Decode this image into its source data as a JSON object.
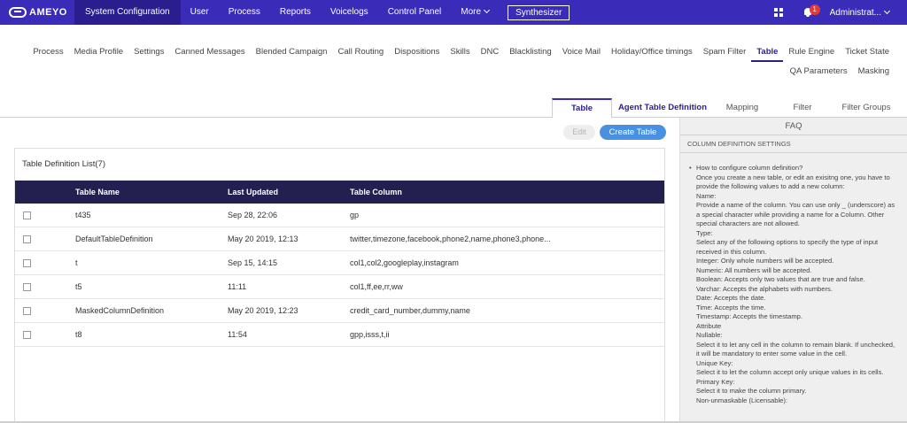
{
  "topbar": {
    "logo_text": "AMEYO",
    "nav": [
      {
        "label": "System Configuration",
        "active": true
      },
      {
        "label": "User"
      },
      {
        "label": "Process"
      },
      {
        "label": "Reports"
      },
      {
        "label": "Voicelogs"
      },
      {
        "label": "Control Panel"
      },
      {
        "label": "More"
      }
    ],
    "synthesizer_label": "Synthesizer",
    "notification_count": "1",
    "admin_label": "Administrat..."
  },
  "submenu": {
    "row1": [
      "Process",
      "Media Profile",
      "Settings",
      "Canned Messages",
      "Blended Campaign",
      "Call Routing",
      "Dispositions",
      "Skills",
      "DNC",
      "Blacklisting",
      "Voice Mail",
      "Holiday/Office timings",
      "Spam Filter",
      "Table",
      "Rule Engine",
      "Ticket State"
    ],
    "row2": [
      "QA Parameters",
      "Masking"
    ],
    "active": "Table"
  },
  "tabs": [
    "Table",
    "Agent Table Definition",
    "Mapping",
    "Filter",
    "Filter Groups"
  ],
  "buttons": {
    "edit": "Edit",
    "create": "Create Table"
  },
  "table": {
    "title": "Table Definition List(7)",
    "columns": [
      "Table Name",
      "Last Updated",
      "Table Column"
    ],
    "rows": [
      {
        "name": "t435",
        "updated": "Sep 28, 22:06",
        "columns": "gp"
      },
      {
        "name": "DefaultTableDefinition",
        "updated": "May 20 2019, 12:13",
        "columns": "twitter,timezone,facebook,phone2,name,phone3,phone..."
      },
      {
        "name": "t",
        "updated": "Sep 15, 14:15",
        "columns": "col1,col2,googleplay,instagram"
      },
      {
        "name": "t5",
        "updated": "11:11",
        "columns": "col1,ff,ee,rr,ww"
      },
      {
        "name": "MaskedColumnDefinition",
        "updated": "May 20 2019, 12:23",
        "columns": "credit_card_number,dummy,name"
      },
      {
        "name": "t8",
        "updated": "11:54",
        "columns": "gpp,isss,t,ii"
      }
    ]
  },
  "faq": {
    "title": "FAQ",
    "section": "COLUMN DEFINITION SETTINGS",
    "question": "How to configure column definition?",
    "lines": [
      "Once you create a new table, or edit an exisitng one, you have to",
      "provide the following values to add a new column:",
      "Name:",
      "Provide a name of the column. You can use only _ (underscore) as",
      "a special character while providing a name for a Column. Other",
      "special characters are not allowed.",
      "Type:",
      "Select any of the following options to specify the type of input",
      "received in this column.",
      "Integer: Only whole numbers will be accepted.",
      "Numeric: All numbers will be accepted.",
      "Boolean: Accepts only two values that are true and false.",
      "Varchar: Accepts the alphabets with numbers.",
      "Date: Accepts the date.",
      "Time: Accepts the time.",
      "Timestamp: Accepts the timestamp.",
      "Attribute",
      "Nullable:",
      "Select it to let any cell in the column to remain blank. If unchecked,",
      "it will be mandatory to enter some value in the cell.",
      "Unique Key:",
      "Select it to let the column accept only unique values in its cells.",
      "Primary Key:",
      "Select it to make the column primary.",
      "Non-unmaskable (Licensable):"
    ]
  }
}
